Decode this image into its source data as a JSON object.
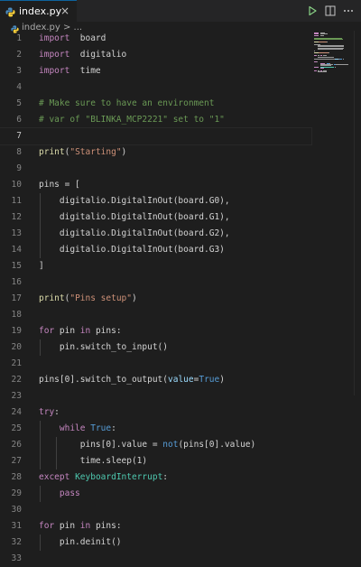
{
  "tab": {
    "filename": "index.py",
    "close_glyph": "×"
  },
  "breadcrumb": {
    "text": "index.py > ..."
  },
  "colors": {
    "accent": "#0e639c",
    "editor_bg": "#1e1e1e",
    "tabbar_bg": "#252526"
  },
  "icons": {
    "run": "run-icon",
    "split": "split-editor-icon",
    "more": "more-actions-icon"
  },
  "code_lines": [
    {
      "n": "1",
      "tokens": [
        [
          "kw-imp",
          "import"
        ],
        [
          "",
          "  board"
        ]
      ]
    },
    {
      "n": "2",
      "tokens": [
        [
          "kw-imp",
          "import"
        ],
        [
          "",
          "  digitalio"
        ]
      ]
    },
    {
      "n": "3",
      "tokens": [
        [
          "kw-imp",
          "import"
        ],
        [
          "",
          "  time"
        ]
      ]
    },
    {
      "n": "4",
      "tokens": []
    },
    {
      "n": "5",
      "tokens": [
        [
          "com",
          "# Make sure to have an environment"
        ]
      ]
    },
    {
      "n": "6",
      "tokens": [
        [
          "com",
          "# var of \"BLINKA_MCP2221\" set to \"1\""
        ]
      ]
    },
    {
      "n": "7",
      "tokens": []
    },
    {
      "n": "8",
      "tokens": [
        [
          "fn",
          "print"
        ],
        [
          "",
          "("
        ],
        [
          "str",
          "\"Starting\""
        ],
        [
          "",
          ")"
        ]
      ]
    },
    {
      "n": "9",
      "tokens": []
    },
    {
      "n": "10",
      "tokens": [
        [
          "",
          "pins = ["
        ]
      ]
    },
    {
      "n": "11",
      "tokens": [
        [
          "",
          "    digitalio.DigitalInOut(board.G0),"
        ]
      ]
    },
    {
      "n": "12",
      "tokens": [
        [
          "",
          "    digitalio.DigitalInOut(board.G1),"
        ]
      ]
    },
    {
      "n": "13",
      "tokens": [
        [
          "",
          "    digitalio.DigitalInOut(board.G2),"
        ]
      ]
    },
    {
      "n": "14",
      "tokens": [
        [
          "",
          "    digitalio.DigitalInOut(board.G3)"
        ]
      ]
    },
    {
      "n": "15",
      "tokens": [
        [
          "",
          "]"
        ]
      ]
    },
    {
      "n": "16",
      "tokens": []
    },
    {
      "n": "17",
      "tokens": [
        [
          "fn",
          "print"
        ],
        [
          "",
          "("
        ],
        [
          "str",
          "\"Pins setup\""
        ],
        [
          "",
          ")"
        ]
      ]
    },
    {
      "n": "18",
      "tokens": []
    },
    {
      "n": "19",
      "tokens": [
        [
          "kw-ctl",
          "for"
        ],
        [
          "",
          " pin "
        ],
        [
          "kw-ctl",
          "in"
        ],
        [
          "",
          " pins:"
        ]
      ]
    },
    {
      "n": "20",
      "tokens": [
        [
          "",
          "    pin.switch_to_input()"
        ]
      ]
    },
    {
      "n": "21",
      "tokens": []
    },
    {
      "n": "22",
      "tokens": [
        [
          "",
          "pins[0].switch_to_output("
        ],
        [
          "param",
          "value"
        ],
        [
          "",
          "="
        ],
        [
          "kw",
          "True"
        ],
        [
          "",
          ")"
        ]
      ]
    },
    {
      "n": "23",
      "tokens": []
    },
    {
      "n": "24",
      "tokens": [
        [
          "kw-ctl",
          "try"
        ],
        [
          "",
          ":"
        ]
      ]
    },
    {
      "n": "25",
      "tokens": [
        [
          "",
          "    "
        ],
        [
          "kw-ctl",
          "while"
        ],
        [
          "",
          " "
        ],
        [
          "kw",
          "True"
        ],
        [
          "",
          ":"
        ]
      ]
    },
    {
      "n": "26",
      "tokens": [
        [
          "",
          "        pins[0].value = "
        ],
        [
          "kw",
          "not"
        ],
        [
          "",
          "(pins[0].value)"
        ]
      ]
    },
    {
      "n": "27",
      "tokens": [
        [
          "",
          "        time.sleep(1)"
        ]
      ]
    },
    {
      "n": "28",
      "tokens": [
        [
          "kw-ctl",
          "except"
        ],
        [
          "",
          " "
        ],
        [
          "cls",
          "KeyboardInterrupt"
        ],
        [
          "",
          ":"
        ]
      ]
    },
    {
      "n": "29",
      "tokens": [
        [
          "",
          "    "
        ],
        [
          "kw-ctl",
          "pass"
        ]
      ]
    },
    {
      "n": "30",
      "tokens": []
    },
    {
      "n": "31",
      "tokens": [
        [
          "kw-ctl",
          "for"
        ],
        [
          "",
          " pin "
        ],
        [
          "kw-ctl",
          "in"
        ],
        [
          "",
          " pins:"
        ]
      ]
    },
    {
      "n": "32",
      "tokens": [
        [
          "",
          "    pin.deinit()"
        ]
      ]
    },
    {
      "n": "33",
      "tokens": []
    }
  ],
  "current_line": "7"
}
